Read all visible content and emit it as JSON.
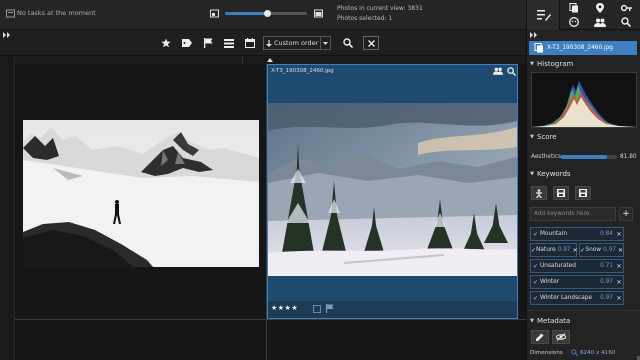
{
  "status": {
    "tasks": "No tasks at the moment",
    "photos_in_view_label": "Photos in current view: 3831",
    "photos_selected_label": "Photos selected: 1",
    "thumb_size_level": 0.52
  },
  "toolbar": {
    "sort_label": "Custom order"
  },
  "cards": [
    {
      "filename": "",
      "stars": ""
    },
    {
      "filename": "X-T3_190308_2460.jpg",
      "stars": "★★★★"
    }
  ],
  "panel": {
    "selected_file": "X-T3_190308_2460.jpg",
    "histogram_title": "Histogram",
    "score_title": "Score",
    "aesthetics_label": "Aesthetics:",
    "aesthetics_value": "81.80",
    "aesthetics_level": 0.818,
    "keywords_title": "Keywords",
    "keyword_placeholder": "Add keywords here",
    "keywords": [
      {
        "label": "Mountain",
        "score": "0.84"
      },
      {
        "label": "Nature",
        "score": "0.97"
      },
      {
        "label": "Snow",
        "score": "0.97"
      },
      {
        "label": "Unsaturated",
        "score": "0.71"
      },
      {
        "label": "Winter",
        "score": "0.97"
      },
      {
        "label": "Winter Landscape",
        "score": "0.97"
      }
    ],
    "metadata_title": "Metadata",
    "dimensions_label": "Dimensions",
    "dimensions_value": "6240 x 4160"
  },
  "colors": {
    "accent": "#3d7fc1",
    "selection_bg": "#1d4a6e"
  }
}
